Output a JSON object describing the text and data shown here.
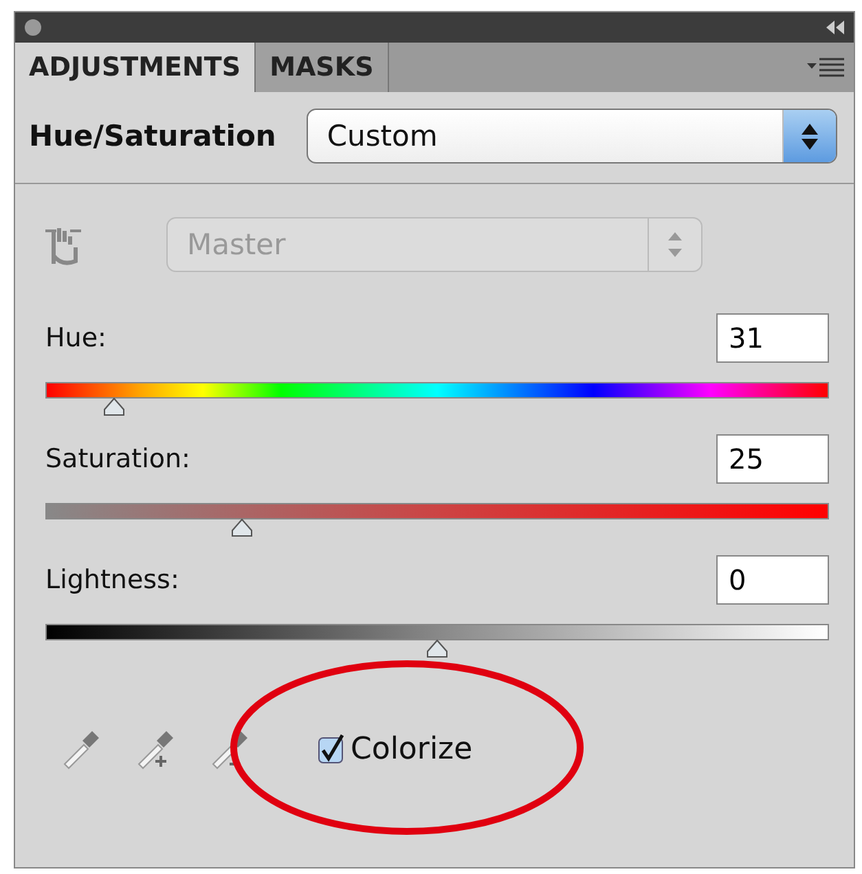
{
  "tabs": [
    {
      "label": "ADJUSTMENTS",
      "selected": true
    },
    {
      "label": "MASKS",
      "selected": false
    }
  ],
  "adjustment": {
    "title": "Hue/Saturation",
    "preset": "Custom"
  },
  "channel": {
    "value": "Master",
    "disabled": true
  },
  "sliders": [
    {
      "kind": "hue",
      "label": "Hue:",
      "value": "31",
      "level": 0.088
    },
    {
      "kind": "saturation",
      "label": "Saturation:",
      "value": "25",
      "level": 0.25
    },
    {
      "kind": "lightness",
      "label": "Lightness:",
      "value": "0",
      "level": 0.5
    }
  ],
  "colorize": {
    "label": "Colorize",
    "checked": true
  }
}
